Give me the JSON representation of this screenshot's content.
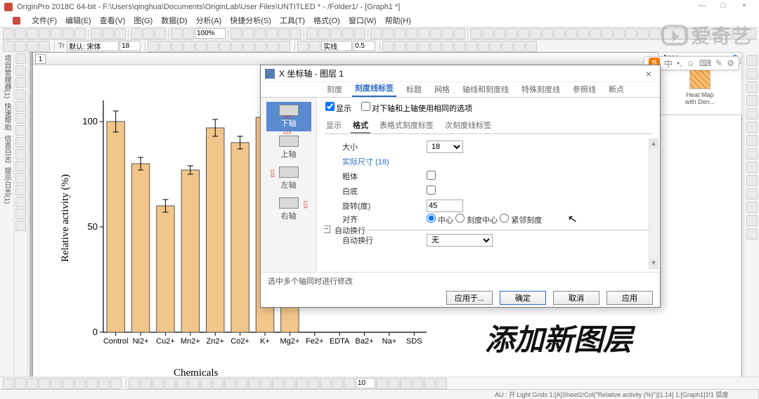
{
  "app": {
    "title": "OriginPro 2018C 64-bit - F:\\Users\\qinghua\\Documents\\OriginLab\\User Files\\UNTITLED * - /Folder1/ - [Graph1 *]",
    "win_min": "—",
    "win_max": "□",
    "win_close": "×"
  },
  "menu": {
    "items": [
      "文件(F)",
      "编辑(E)",
      "查看(V)",
      "图(G)",
      "数据(D)",
      "分析(A)",
      "快捷分析(S)",
      "工具(T)",
      "格式(O)",
      "窗口(W)",
      "帮助(H)"
    ]
  },
  "toolbar2": {
    "zoom": "100%",
    "font_label": "默认: 宋体",
    "font_size": "18",
    "line_label": "实线",
    "line_w": "0.5"
  },
  "leftbar": {
    "labels": [
      "项目管理器(1)",
      "快速帮助",
      "信息日志",
      "提示日志(1)"
    ]
  },
  "graph": {
    "layer_btn": "1"
  },
  "apps": {
    "header": "Apps",
    "help": "?",
    "item1_l1": "Heat Map",
    "item1_l2": "with Den..."
  },
  "ime": {
    "logo": "S",
    "mode": "中",
    "punct": "•,",
    "face": "☺",
    "kbd": "⌨",
    "tool": "✎",
    "set": "⚙"
  },
  "dialog": {
    "title": "X 坐标轴 - 图层 1",
    "tabs": [
      "刻度",
      "刻度线标签",
      "标题",
      "网格",
      "轴线和刻度线",
      "特殊刻度线",
      "参照线",
      "断点"
    ],
    "active_tab": 1,
    "axis_items": [
      "下轴",
      "上轴",
      "左轴",
      "右轴"
    ],
    "selected_axis": 0,
    "check_show": "显示",
    "check_same": "对下轴和上轴使用相同的选项",
    "sub_tabs": [
      "显示",
      "格式",
      "表格式刻度标签",
      "次刻度线标签"
    ],
    "active_sub": 1,
    "lab_size": "大小",
    "val_size": "18",
    "lab_actual": "实际尺寸 (18)",
    "lab_bold": "粗体",
    "lab_white": "白底",
    "lab_rotate": "旋转(度)",
    "val_rotate": "45",
    "lab_align": "对齐",
    "align_opts": [
      "中心",
      "刻度中心",
      "紧邻刻度"
    ],
    "align_selected": 0,
    "group_wrap": "自动换行",
    "lab_wrap": "自动换行",
    "val_wrap": "无",
    "footer_hint": "选中多个轴同时进行修改",
    "btn_applyto": "应用于...",
    "btn_ok": "确定",
    "btn_cancel": "取消",
    "btn_apply": "应用"
  },
  "bigtext": "添加新图层",
  "watermark": "爱奇艺",
  "status": {
    "left": "",
    "right": "AU : 开  Light Grids  1:[A]Sheet1!Col(\"Relative activity (%)\")[1:14]  1:[Graph1]1!1  弧度"
  },
  "bottom_tb": {
    "num": "10"
  },
  "chart_data": {
    "type": "bar",
    "categories": [
      "Control",
      "Ni2+",
      "Cu2+",
      "Mn2+",
      "Zn2+",
      "Co2+",
      "K+",
      "Mg2+",
      "Fe2+",
      "EDTA",
      "Ba2+",
      "Na+",
      "SDS"
    ],
    "values": [
      100,
      80,
      60,
      77,
      97,
      90,
      102,
      105,
      null,
      null,
      null,
      null,
      null
    ],
    "errors": [
      5,
      3,
      3,
      2,
      4,
      3,
      5,
      4,
      null,
      null,
      null,
      null,
      null
    ],
    "title": "",
    "xlabel": "Chemicals",
    "ylabel": "Relative activity (%)",
    "ylim": [
      0,
      110
    ],
    "yticks": [
      0,
      50,
      100
    ]
  }
}
